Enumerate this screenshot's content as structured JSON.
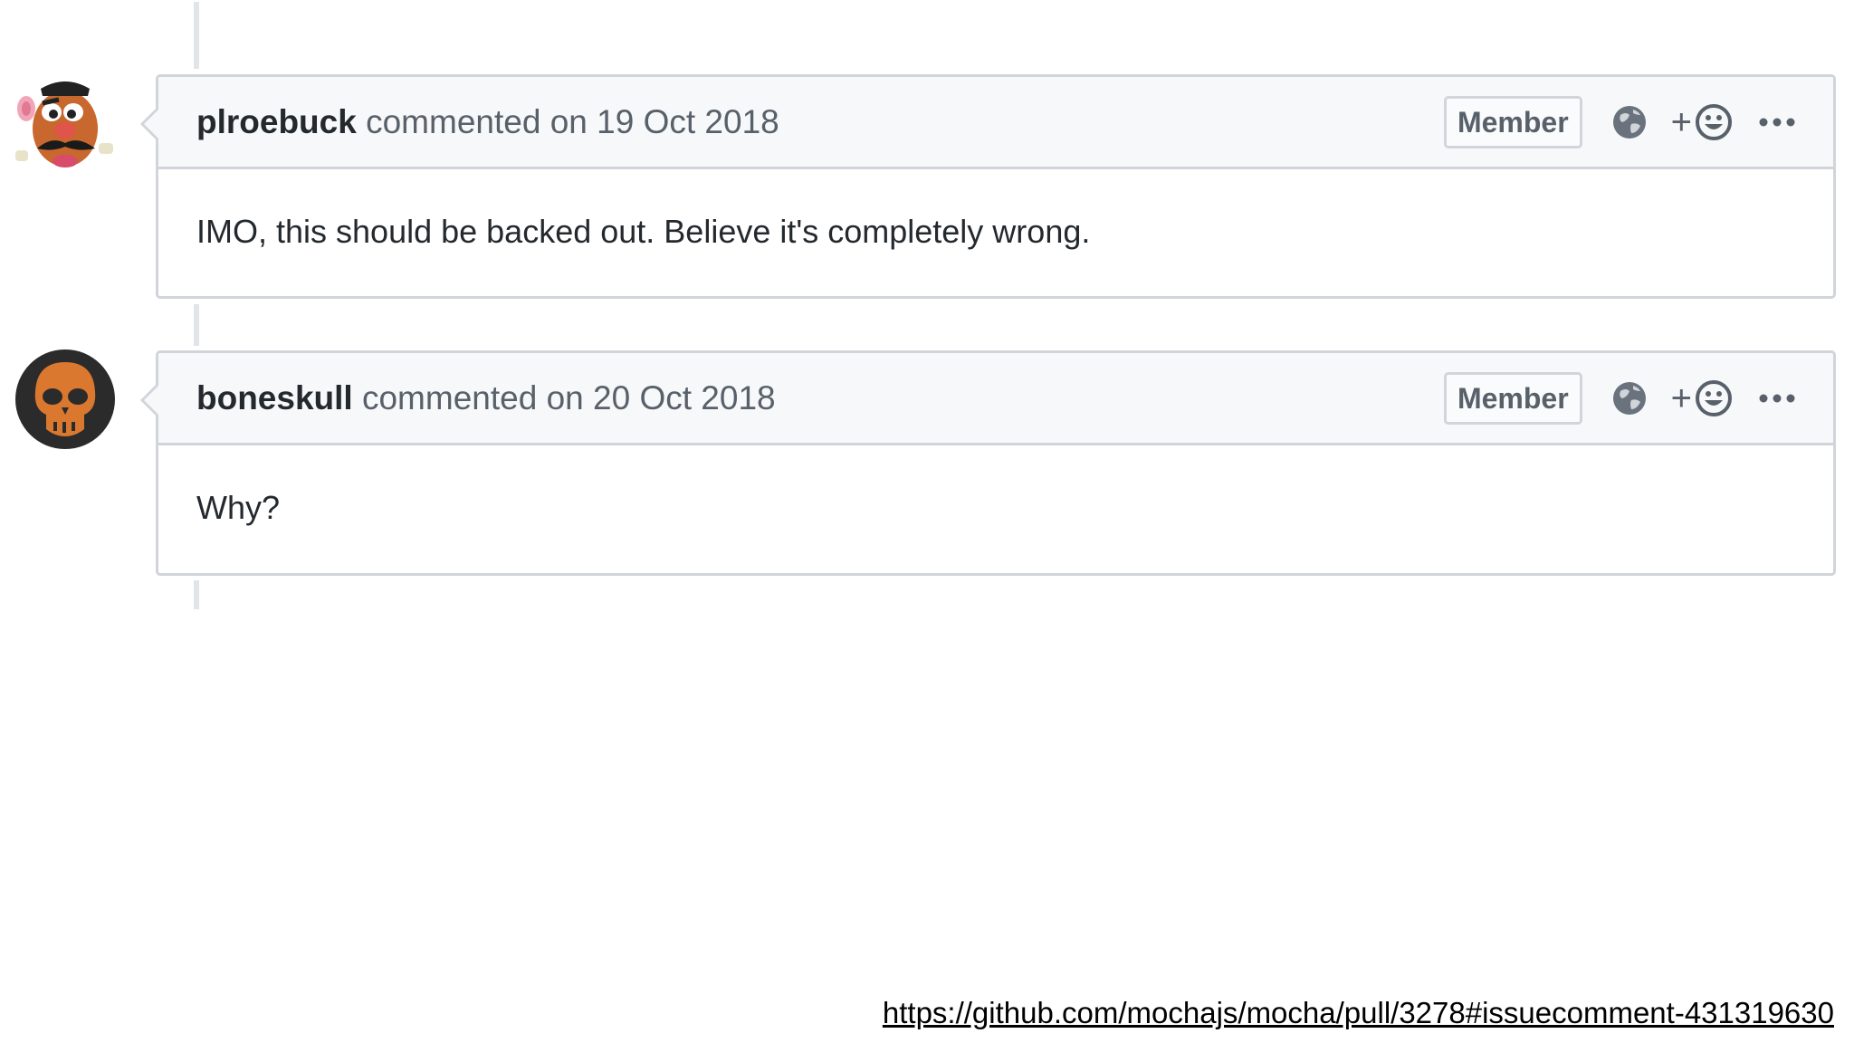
{
  "comments": [
    {
      "author": "plroebuck",
      "action_text": "commented on 19 Oct 2018",
      "badge": "Member",
      "plus": "+",
      "body": "IMO, this should be backed out. Believe it's completely wrong.",
      "avatar_icon": "mr-potato-head-avatar"
    },
    {
      "author": "boneskull",
      "action_text": "commented on 20 Oct 2018",
      "badge": "Member",
      "plus": "+",
      "body": "Why?",
      "avatar_icon": "orange-skull-avatar"
    }
  ],
  "source_url": "https://github.com/mochajs/mocha/pull/3278#issuecomment-431319630",
  "colors": {
    "header_bg": "#f6f8fa",
    "border": "#d1d5da",
    "skull_orange": "#d9782e",
    "text": "#24292e",
    "muted": "#586069"
  }
}
